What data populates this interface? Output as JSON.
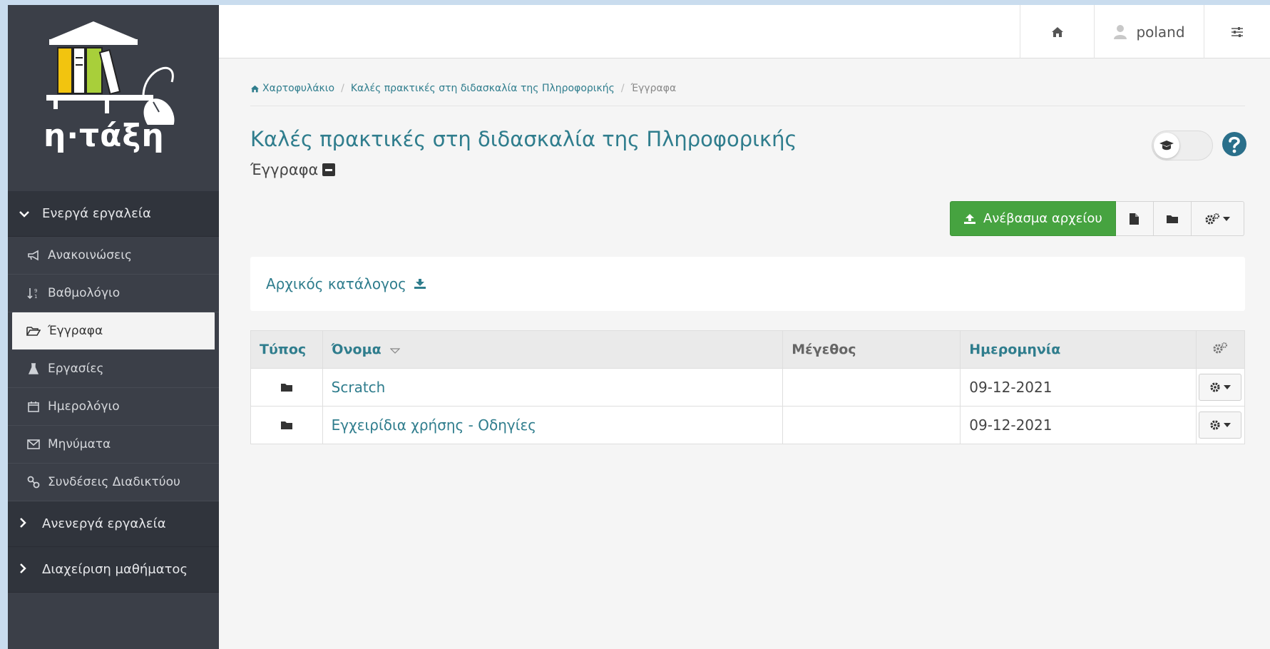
{
  "logo": {
    "text": "η·τάξη"
  },
  "sidebar": {
    "active_section": "Ενεργά εργαλεία",
    "items": [
      {
        "label": "Ανακοινώσεις",
        "icon": "megaphone-icon"
      },
      {
        "label": "Βαθμολόγιο",
        "icon": "sort-numeric-icon"
      },
      {
        "label": "Έγγραφα",
        "icon": "folder-open-icon",
        "active": true
      },
      {
        "label": "Εργασίες",
        "icon": "flask-icon"
      },
      {
        "label": "Ημερολόγιο",
        "icon": "calendar-icon"
      },
      {
        "label": "Μηνύματα",
        "icon": "envelope-icon"
      },
      {
        "label": "Συνδέσεις Διαδικτύου",
        "icon": "link-icon"
      }
    ],
    "inactive_section": "Ανενεργά εργαλεία",
    "admin_section": "Διαχείριση μαθήματος"
  },
  "topbar": {
    "home_icon": "home-icon",
    "user_icon": "user-icon",
    "username": "poland",
    "settings_icon": "sliders-icon"
  },
  "breadcrumb": {
    "home": "Χαρτοφυλάκιο",
    "course": "Καλές πρακτικές στη διδασκαλία της Πληροφορικής",
    "current": "Έγγραφα"
  },
  "page": {
    "title": "Καλές πρακτικές στη διδασκαλία της Πληροφορικής",
    "subtitle": "Έγγραφα"
  },
  "toolbar": {
    "upload_label": "Ανέβασμα αρχείου"
  },
  "root_dir": {
    "label": "Αρχικός κατάλογος"
  },
  "table": {
    "headers": {
      "type": "Τύπος",
      "name": "Όνομα",
      "size": "Μέγεθος",
      "date": "Ημερομηνία"
    },
    "rows": [
      {
        "name": "Scratch",
        "size": "",
        "date": "09-12-2021"
      },
      {
        "name": "Εγχειρίδια χρήσης - Οδηγίες",
        "size": "",
        "date": "09-12-2021"
      }
    ]
  },
  "colors": {
    "sidebar_bg": "#3b3f48",
    "accent": "#2f7d8d",
    "upload_green": "#46a340",
    "help_blue": "#2a6f8a"
  }
}
